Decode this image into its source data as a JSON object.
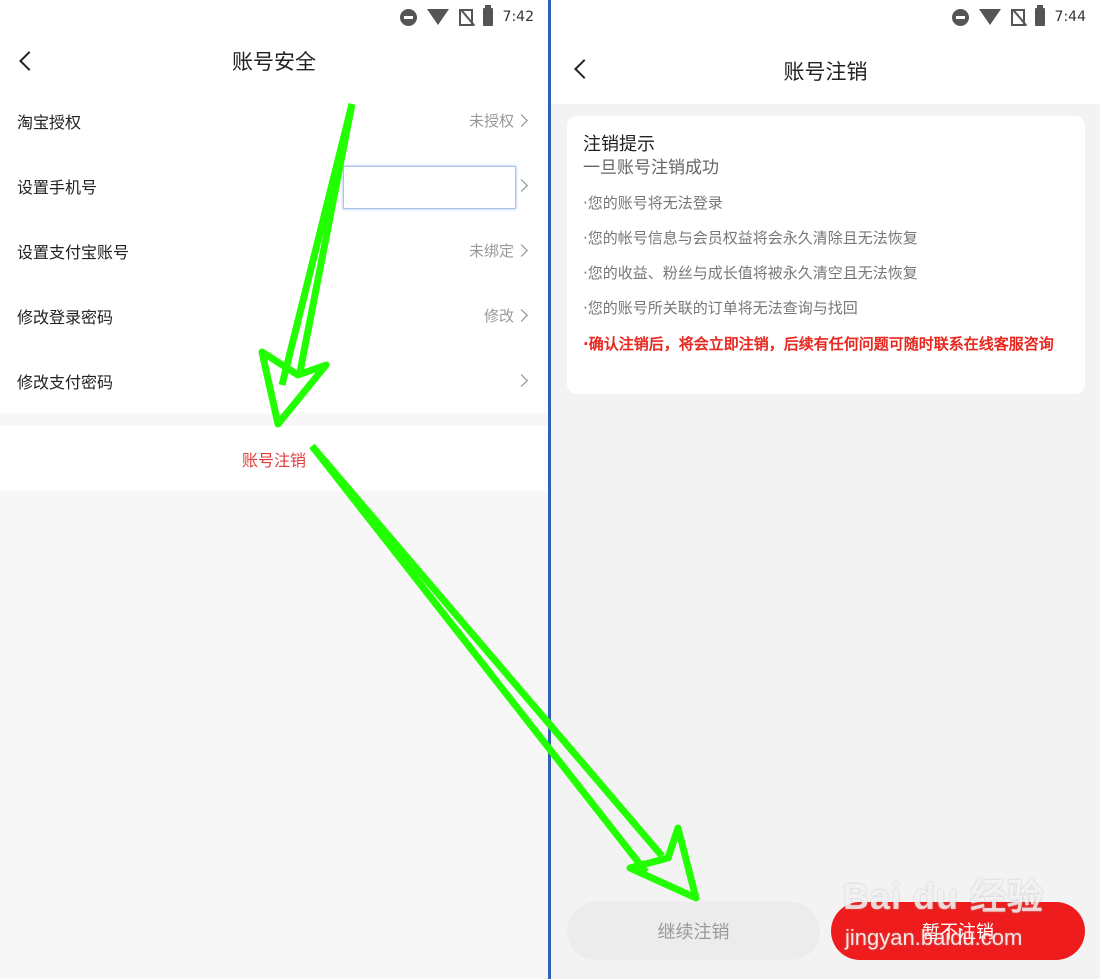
{
  "left_screen": {
    "status_time": "7:42",
    "title": "账号安全",
    "rows": [
      {
        "label": "淘宝授权",
        "value": "未授权"
      },
      {
        "label": "设置手机号",
        "value": ""
      },
      {
        "label": "设置支付宝账号",
        "value": "未绑定"
      },
      {
        "label": "修改登录密码",
        "value": "修改"
      },
      {
        "label": "修改支付密码",
        "value": ""
      }
    ],
    "deactivate_label": "账号注销"
  },
  "right_screen": {
    "status_time": "7:44",
    "title": "账号注销",
    "card": {
      "title": "注销提示",
      "subtitle": "一旦账号注销成功",
      "items": [
        "·您的账号将无法登录",
        "·您的帐号信息与会员权益将会永久清除且无法恢复",
        "·您的收益、粉丝与成长值将被永久清空且无法恢复",
        "·您的账号所关联的订单将无法查询与找回"
      ],
      "warning": "·确认注销后，将会立即注销，后续有任何问题可随时联系在线客服咨询"
    },
    "continue_button": "继续注销",
    "cancel_button": "暂不注销"
  },
  "watermark": {
    "logo_text": "Bai du 经验",
    "url_text": "jingyan.baidu.com"
  },
  "colors": {
    "accent_red": "#ee1c1c",
    "annotation_green": "#22ff00"
  }
}
